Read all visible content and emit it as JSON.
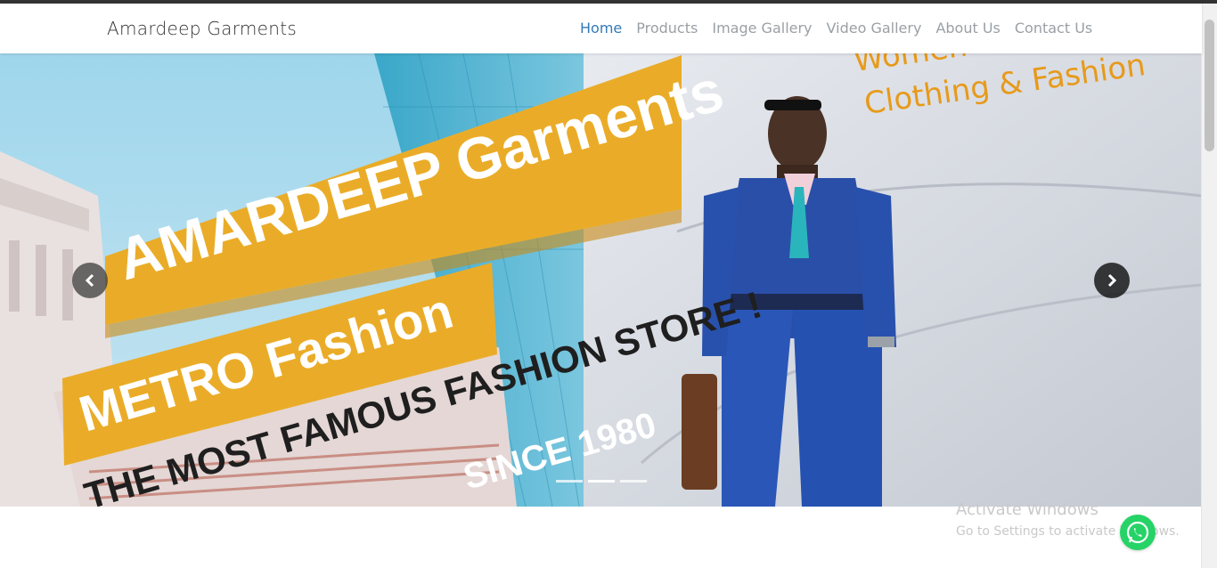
{
  "header": {
    "brand": "Amardeep Garments",
    "nav": [
      "Home",
      "Products",
      "Image Gallery",
      "Video Gallery",
      "About Us",
      "Contact Us"
    ],
    "active_index": 0
  },
  "hero": {
    "banner_title": "AMARDEEP Garments",
    "banner_subtitle": "METRO Fashion",
    "tagline": "THE MOST FAMOUS FASHION STORE !",
    "since": "SINCE 1980",
    "top_right_line1": "Women",
    "top_right_line2": "Clothing & Fashion",
    "accent_color": "#eaac28",
    "slide_count": 3,
    "active_slide": 1
  },
  "overlay": {
    "activate_title": "Activate Windows",
    "activate_sub": "Go to Settings to activate Windows."
  },
  "icons": {
    "prev": "chevron-left-icon",
    "next": "chevron-right-icon",
    "whatsapp": "whatsapp-icon"
  }
}
